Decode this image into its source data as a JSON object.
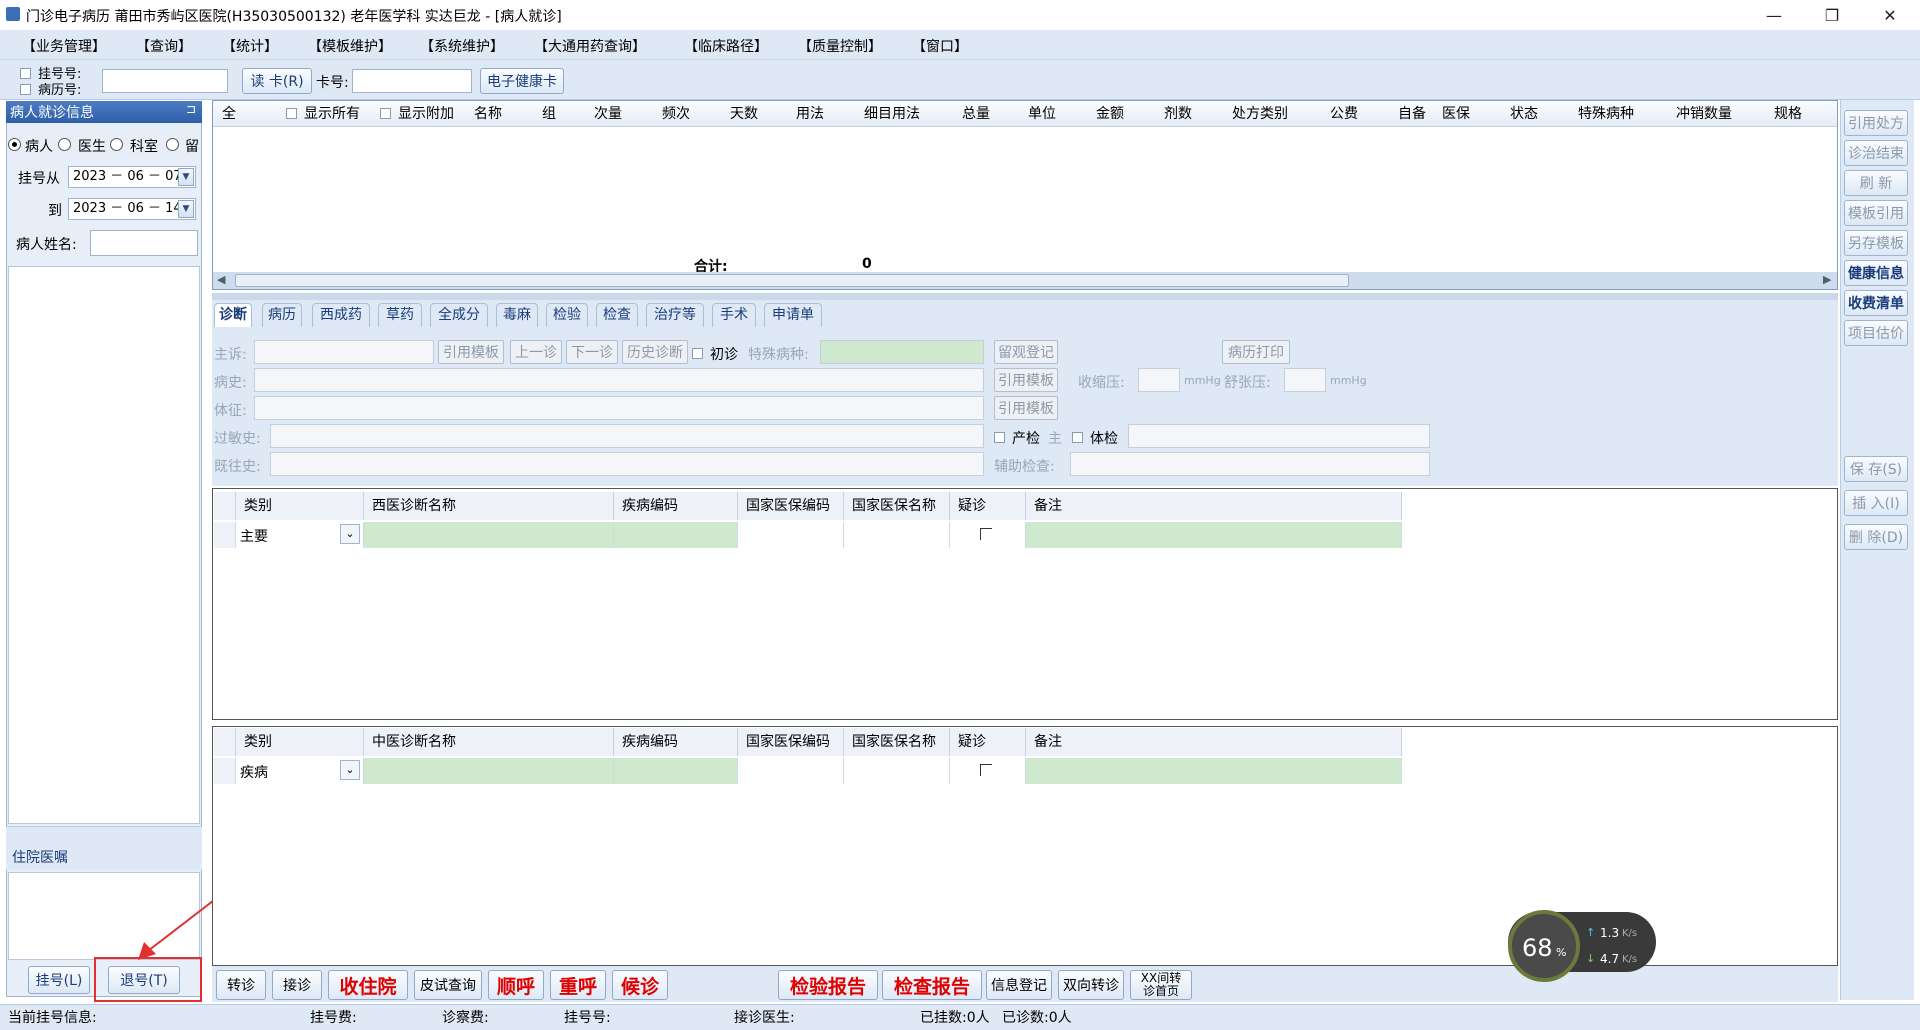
{
  "window": {
    "title": "门诊电子病历  莆田市秀屿区医院(H35030500132)  老年医学科  实达巨龙 - [病人就诊]",
    "minimize": "—",
    "restore": "❐",
    "close": "✕"
  },
  "menu": [
    "【业务管理】",
    "【查询】",
    "【统计】",
    "【模板维护】",
    "【系统维护】",
    "【大通用药查询】",
    "【临床路径】",
    "【质量控制】",
    "【窗口】"
  ],
  "toolbar": {
    "reg_no_label": "挂号号:",
    "record_no_label": "病历号:",
    "read_card": "读 卡(R)",
    "card_no_label": "卡号:",
    "health_card": "电子健康卡"
  },
  "left": {
    "header": "病人就诊信息",
    "pin": "⊐",
    "radio": [
      "病人",
      "医生",
      "科室",
      "留"
    ],
    "reg_from_label": "挂号从",
    "reg_to_label": "到",
    "date_from": "2023 － 06 － 07",
    "date_to": "2023 － 06 － 14",
    "patient_name_label": "病人姓名:",
    "inpatient_orders": "住院医嘱",
    "btn_register": "挂号(L)",
    "btn_unregister": "退号(T)"
  },
  "rx_grid": {
    "columns": [
      "全",
      "显示所有",
      "显示附加",
      "名称",
      "组",
      "次量",
      "频次",
      "天数",
      "用法",
      "细目用法",
      "总量",
      "单位",
      "金额",
      "剂数",
      "处方类别",
      "公费",
      "自备",
      "医保",
      "状态",
      "特殊病种",
      "冲销数量",
      "规格"
    ],
    "total_label": "合计:",
    "total_value": "0"
  },
  "tabs": [
    "诊断",
    "病历",
    "西成药",
    "草药",
    "全成分",
    "毒麻",
    "检验",
    "检查",
    "治疗等",
    "手术",
    "申请单"
  ],
  "form": {
    "chief_complaint": "主诉:",
    "cite_template": "引用模板",
    "prev_visit": "上一诊",
    "next_visit": "下一诊",
    "history_visit": "历史诊断",
    "first_visit": "初诊",
    "special_disease": "特殊病种:",
    "observation_reg": "留观登记",
    "print_record": "病历打印",
    "history": "病史:",
    "systolic": "收缩压:",
    "diastolic": "舒张压:",
    "mmhg": "mmHg",
    "physical": "体征:",
    "allergy": "过敏史:",
    "prenatal": "产检",
    "main_short": "主",
    "physical_exam": "体检",
    "past_history": "既往史:",
    "aux_exam": "辅助检查:"
  },
  "wm_grid": {
    "columns": [
      "类别",
      "西医诊断名称",
      "疾病编码",
      "国家医保编码",
      "国家医保名称",
      "疑诊",
      "备注"
    ],
    "row_type": "主要"
  },
  "tcm_grid": {
    "columns": [
      "类别",
      "中医诊断名称",
      "疾病编码",
      "国家医保编码",
      "国家医保名称",
      "疑诊",
      "备注"
    ],
    "row_type": "疾病"
  },
  "right_buttons": [
    "引用处方",
    "诊治结束",
    "刷  新",
    "模板引用",
    "另存模板",
    "健康信息",
    "收费清单",
    "项目估价"
  ],
  "right_buttons2": [
    "保 存(S)",
    "插 入(I)",
    "删 除(D)"
  ],
  "bottom_buttons": [
    "转诊",
    "接诊",
    "收住院",
    "皮试查询",
    "顺呼",
    "重呼",
    "候诊",
    "检验报告",
    "检查报告",
    "信息登记",
    "双向转诊",
    "XX间转诊首页"
  ],
  "net_widget": {
    "cpu": "68",
    "percent": "%",
    "up": "1.3",
    "down": "4.7",
    "unit": "K/s"
  },
  "status": {
    "current_reg": "当前挂号信息:",
    "reg_fee": "挂号费:",
    "consult_fee": "诊察费:",
    "reg_no": "挂号号:",
    "doctor": "接诊医生:",
    "registered": "已挂数:0人",
    "seen": "已诊数:0人"
  }
}
